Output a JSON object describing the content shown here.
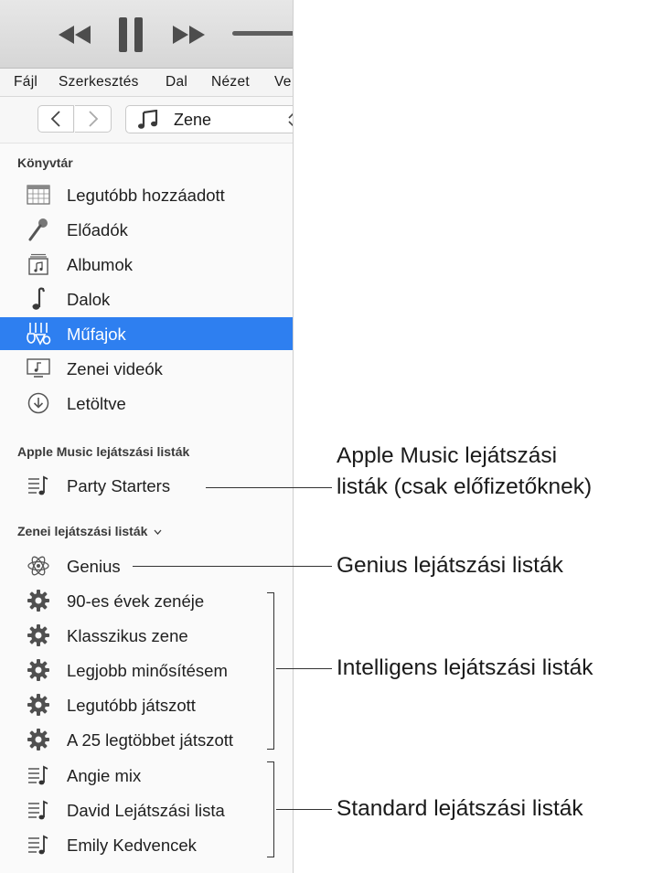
{
  "menu": [
    "Fájl",
    "Szerkesztés",
    "Dal",
    "Nézet",
    "Ve"
  ],
  "media_selector": {
    "label": "Zene"
  },
  "library": {
    "header": "Könyvtár",
    "items": [
      {
        "label": "Legutóbb hozzáadott",
        "icon": "calendar-grid-icon"
      },
      {
        "label": "Előadók",
        "icon": "microphone-icon"
      },
      {
        "label": "Albumok",
        "icon": "album-icon"
      },
      {
        "label": "Dalok",
        "icon": "music-note-icon"
      },
      {
        "label": "Műfajok",
        "icon": "instruments-icon",
        "selected": true
      },
      {
        "label": "Zenei videók",
        "icon": "music-video-icon"
      },
      {
        "label": "Letöltve",
        "icon": "download-circle-icon"
      }
    ]
  },
  "apple_music_playlists": {
    "header": "Apple Music lejátszási listák",
    "items": [
      {
        "label": "Party Starters",
        "icon": "playlist-icon"
      }
    ]
  },
  "music_playlists": {
    "header": "Zenei lejátszási listák",
    "genius": {
      "label": "Genius",
      "icon": "atom-icon"
    },
    "smart": [
      {
        "label": "90-es évek zenéje",
        "icon": "gear-icon"
      },
      {
        "label": "Klasszikus zene",
        "icon": "gear-icon"
      },
      {
        "label": "Legjobb minősítésem",
        "icon": "gear-icon"
      },
      {
        "label": "Legutóbb játszott",
        "icon": "gear-icon"
      },
      {
        "label": "A 25 legtöbbet játszott",
        "icon": "gear-icon"
      }
    ],
    "standard": [
      {
        "label": "Angie mix",
        "icon": "playlist-icon"
      },
      {
        "label": "David Lejátszási lista",
        "icon": "playlist-icon"
      },
      {
        "label": "Emily Kedvencek",
        "icon": "playlist-icon"
      }
    ]
  },
  "callouts": {
    "apple_music_line1": "Apple Music lejátszási",
    "apple_music_line2": "listák (csak előfizetőknek)",
    "genius": "Genius lejátszási listák",
    "smart": "Intelligens lejátszási listák",
    "standard": "Standard lejátszási listák"
  },
  "colors": {
    "selection": "#2e7ff0",
    "icon_gray": "#5a5a5a"
  }
}
